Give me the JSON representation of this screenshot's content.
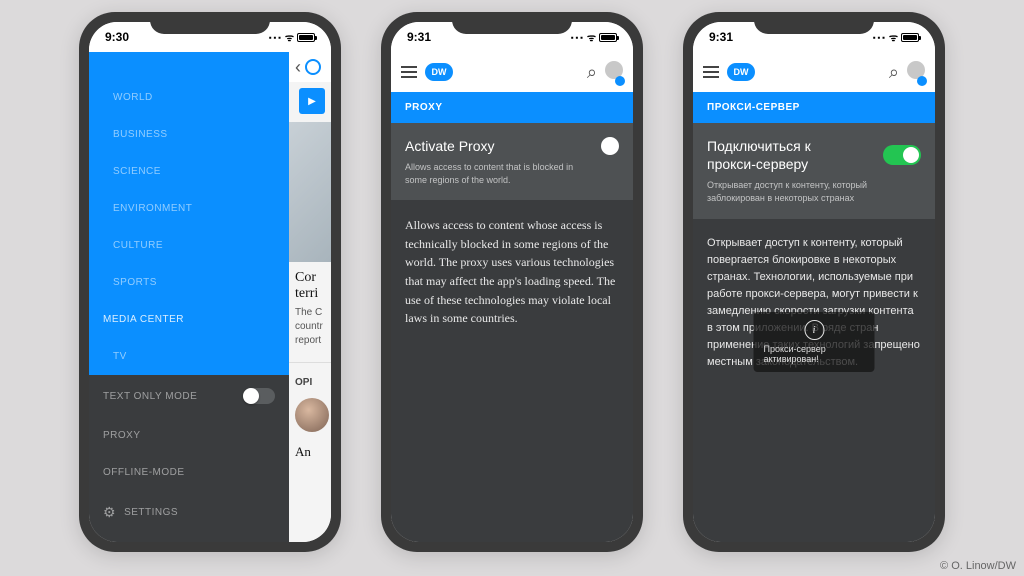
{
  "credit": "© O. Linow/DW",
  "phone1": {
    "time": "9:30",
    "menu_blue": [
      "WORLD",
      "BUSINESS",
      "SCIENCE",
      "ENVIRONMENT",
      "CULTURE",
      "SPORTS"
    ],
    "menu_blue_top": [
      "MEDIA CENTER",
      "TV"
    ],
    "menu_dark": {
      "text_only": "TEXT ONLY MODE",
      "proxy": "PROXY",
      "offline": "OFFLINE-MODE",
      "settings": "SETTINGS"
    },
    "content": {
      "headline_a": "Cor",
      "headline_b": "terri",
      "body": "The C\ncountr\nreport",
      "tab": "OPI",
      "an": "An"
    }
  },
  "phone2": {
    "time": "9:31",
    "logo": "DW",
    "section": "PROXY",
    "card_title": "Activate Proxy",
    "card_sub": "Allows access to content that is blocked in some regions of the world.",
    "body": "Allows access to content whose access is technically blocked in some regions of the world. The proxy uses various technologies that may affect the app's loading speed. The use of these technologies may violate local laws in some countries."
  },
  "phone3": {
    "time": "9:31",
    "logo": "DW",
    "section": "ПРОКСИ-СЕРВЕР",
    "card_title": "Подключиться к прокси-серверу",
    "card_sub": "Открывает доступ к контенту, который заблокирован в некоторых странах",
    "body": "Открывает доступ к контенту, который повергается блокировке в некоторых странах. Технологии, используемые при работе прокси-сервера, могут привести к замедлению скорости загрузки контента в этом приложении. В ряде стран применение таких технологий запрещено местным законодательством.",
    "toast": "Прокси-сервер активирован!"
  }
}
